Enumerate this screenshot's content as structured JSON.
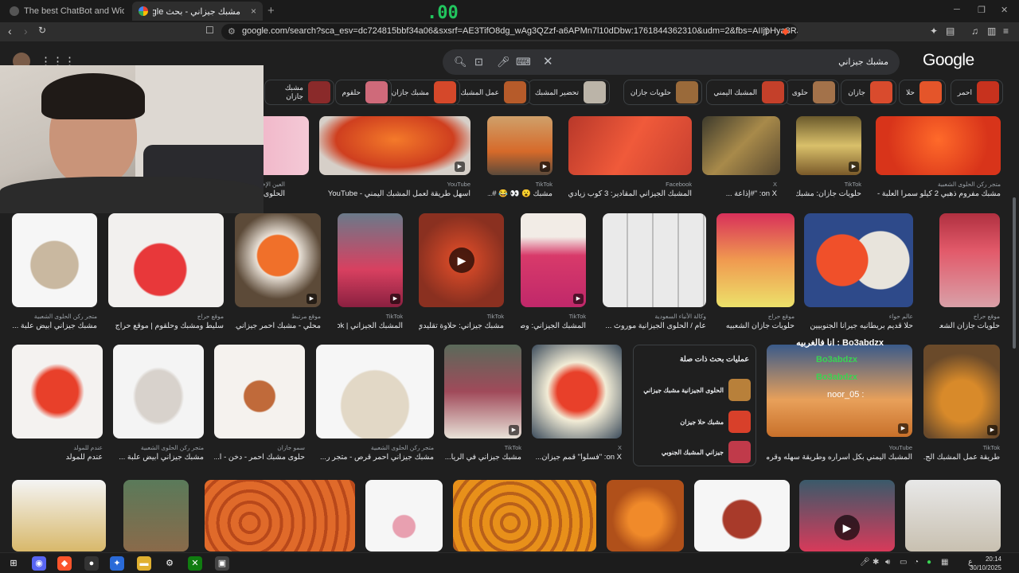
{
  "browser": {
    "tabs": [
      {
        "title": "The best ChatBot and Widgets for Ki",
        "close": "×"
      },
      {
        "title": "مشبك جيزاني - بحث Google",
        "close": "×"
      }
    ],
    "new_tab": "+",
    "timer": ".00",
    "url": "google.com/search?sca_esv=dc724815bbf34a06&sxsrf=AE3TifO8dg_wAg3QZzf-a6APMn7l10dDbw:1761844362310&udm=2&fbs=AIIjpHya8RJaG7GTGOV..."
  },
  "google": {
    "logo": "Google",
    "query": "مشبك جيزاني",
    "chips": [
      "احمر",
      "حلا",
      "جازان",
      "حلوى",
      "المشبك اليمني",
      "حلويات جازان",
      "تحضير المشبك",
      "عمل المشبك",
      "مشبك جازان",
      "حلقوم",
      "مشبك جازان"
    ],
    "rows": [
      [
        {
          "source": "متجر ركن الحلوى الشعبية",
          "title": "مشبك مفروم ذهبي 2 كيلو سمرا العلبة - متجر ..."
        },
        {
          "source": "TikTok",
          "title": "حلويات جازان: مشبك ..."
        },
        {
          "source": "X",
          "title": "on X: \"#إذاعة ..."
        },
        {
          "source": "Facebook",
          "title": "المشبك الجيزاني المقادير: 3 كوب زيادي ..."
        },
        {
          "source": "TikTok",
          "title": "مشبك 😮 👀 😂 #..."
        },
        {
          "source": "YouTube",
          "title": "اسهل طريقة لعمل المشبك اليمني - YouTube"
        },
        {
          "source": "العين الإخبارية",
          "title": "الحلوى الجيزانية..."
        }
      ],
      [
        {
          "source": "موقع حراج",
          "title": "حلويات جازان الشعبيه"
        },
        {
          "source": "عالم حواء",
          "title": "حلا قديم بريطانيه جيرانا الجنوبيين"
        },
        {
          "source": "موقع حراج",
          "title": "حلويات جازان الشعبيه"
        },
        {
          "source": "وكالة الأنباء السعودية",
          "title": "عام / الحلوى الجيزانية موروث ..."
        },
        {
          "source": "TikTok",
          "title": "المشبك الجيزاني: وصفة..."
        },
        {
          "source": "TikTok",
          "title": "مشبك جيزاني: حلاوة تقليدي..."
        },
        {
          "source": "TikTok",
          "title": "المشبك الجيزاني | ok..."
        },
        {
          "source": "موقع مرتبط",
          "title": "محلي - مشبك احمر جيزاني..."
        },
        {
          "source": "موقع حراج",
          "title": "سليط ومشبك وحلقوم | موقع حراج"
        },
        {
          "source": "متجر ركن الحلوى الشعبية",
          "title": "مشبك جيزاني أبيض علبة ..."
        }
      ],
      [
        {
          "source": "TikTok",
          "title": "طريقة عمل المشبك الج..."
        },
        {
          "source": "YouTube",
          "title": "المشبك اليمني بكل اسراره وطريقة سهله وقرمشة..."
        },
        {
          "source": "X",
          "title": "on X: \"فسلوا\" قمم جيزان..."
        },
        {
          "source": "TikTok",
          "title": "مشبك جيزاني في الريا..."
        },
        {
          "source": "متجر ركن الحلوى الشعبية",
          "title": "مشبك جيزاني احمر قرص - متجر ر..."
        },
        {
          "source": "سمو جازان",
          "title": "حلوى مشبك احمر - دخن - ا..."
        },
        {
          "source": "متجر ركن الحلوى الشعبية",
          "title": "مشبك جيزاني أبيض علبة ..."
        },
        {
          "source": "عندم للمولد",
          "title": "عندم للمولد"
        }
      ]
    ],
    "related": {
      "heading": "عمليات بحث ذات صلة",
      "items": [
        "الحلوى الجيزانية مشبك جيزاني",
        "مشبك حلا جيزان",
        "جيزاني المشبك الجنوبي"
      ]
    }
  },
  "overlay": {
    "lines": [
      "انا فالغربيه : Bo3abdzx",
      "Bo3abdzx",
      "Bo3abdzx",
      "noor_05 :"
    ]
  },
  "taskbar": {
    "time": "20:14",
    "date": "30/10/2025",
    "lang": "ع"
  },
  "colors": {
    "accent_green": "#22c55e",
    "overlay_red": "#ff3b3b",
    "overlay_green": "#39d353"
  }
}
